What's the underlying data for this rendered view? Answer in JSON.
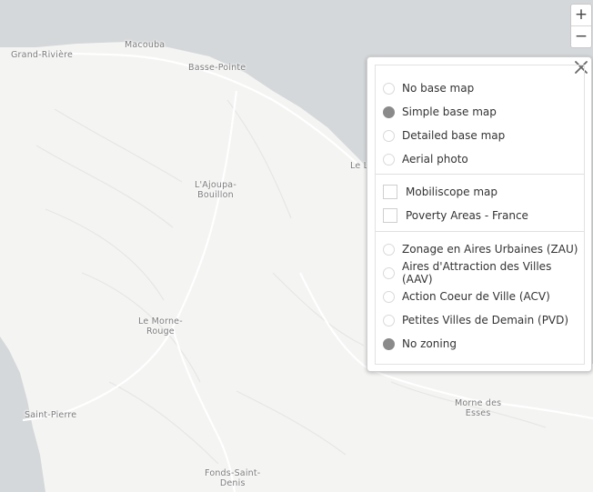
{
  "map": {
    "colors": {
      "land": "#f4f4f3",
      "sea": "#d5d8da",
      "road": "#ffffff",
      "relief": "#e9e9e8"
    },
    "places": [
      {
        "id": "grand-riviere",
        "label": "Grand-Rivière"
      },
      {
        "id": "macouba",
        "label": "Macouba"
      },
      {
        "id": "basse-pointe",
        "label": "Basse-Pointe"
      },
      {
        "id": "le-lorrain",
        "label": "Le L"
      },
      {
        "id": "ajoupa-bouillon",
        "label": "L'Ajoupa-\nBouillon"
      },
      {
        "id": "morne-rouge",
        "label": "Le Morne-\nRouge"
      },
      {
        "id": "saint-pierre",
        "label": "Saint-Pierre"
      },
      {
        "id": "morne-des-esses",
        "label": "Morne des\nEsses"
      },
      {
        "id": "fonds-saint-denis",
        "label": "Fonds-Saint-\nDenis"
      }
    ]
  },
  "zoom": {
    "in_label": "+",
    "out_label": "−"
  },
  "layers": {
    "close_icon": "close-icon",
    "basemaps": [
      {
        "label": "No base map",
        "checked": false
      },
      {
        "label": "Simple base map",
        "checked": true
      },
      {
        "label": "Detailed base map",
        "checked": false
      },
      {
        "label": "Aerial photo",
        "checked": false
      }
    ],
    "overlays": [
      {
        "label": "Mobiliscope map",
        "checked": false
      },
      {
        "label": "Poverty Areas - France",
        "checked": false
      }
    ],
    "zonings": [
      {
        "label": "Zonage en Aires Urbaines (ZAU)",
        "checked": false
      },
      {
        "label": "Aires d'Attraction des Villes (AAV)",
        "checked": false
      },
      {
        "label": "Action Coeur de Ville (ACV)",
        "checked": false
      },
      {
        "label": "Petites Villes de Demain (PVD)",
        "checked": false
      },
      {
        "label": "No zoning",
        "checked": true
      }
    ]
  }
}
